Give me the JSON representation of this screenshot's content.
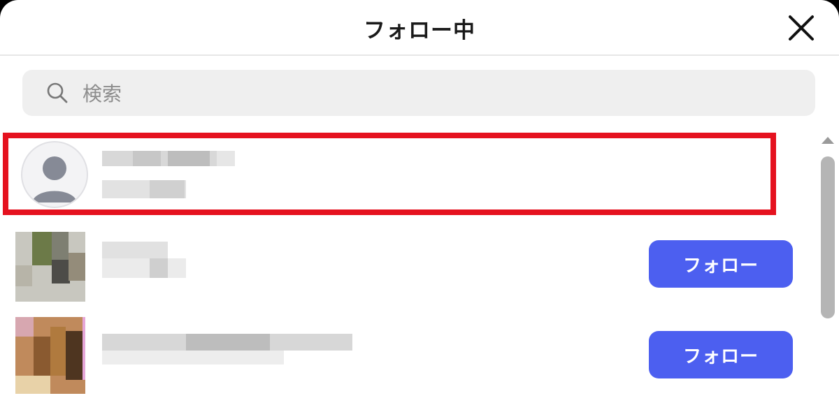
{
  "dialog": {
    "title": "フォロー中"
  },
  "search": {
    "placeholder": "検索"
  },
  "users": [
    {
      "highlighted": true,
      "avatar": "default-avatar-icon",
      "follow_label": ""
    },
    {
      "highlighted": false,
      "avatar": "blurred-photo",
      "follow_label": "フォロー"
    },
    {
      "highlighted": false,
      "avatar": "blurred-photo",
      "follow_label": "フォロー"
    }
  ],
  "colors": {
    "accent": "#4c5ff0",
    "highlight_border": "#e5121f",
    "search_bg": "#efefef"
  },
  "icons": {
    "close": "close-icon",
    "search": "search-icon",
    "scroll_up": "scroll-up-arrow-icon"
  }
}
